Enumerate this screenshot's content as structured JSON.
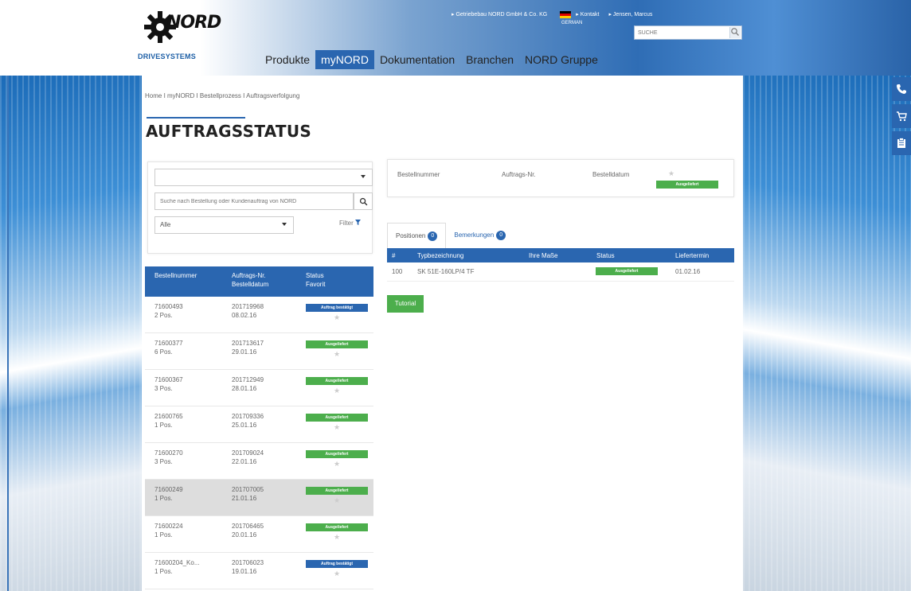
{
  "header": {
    "logo_text": "NORD",
    "logo_sub": "DRIVESYSTEMS",
    "top_links": [
      "Getriebebau NORD GmbH & Co. KG",
      "Kontakt",
      "Jensen, Marcus"
    ],
    "language": "GERMAN",
    "search_placeholder": "SUCHE",
    "nav": [
      "Produkte",
      "myNORD",
      "Dokumentation",
      "Branchen",
      "NORD Gruppe"
    ],
    "active_nav": "myNORD"
  },
  "breadcrumb": "Home I myNORD I Bestellprozess I Auftragsverfolgung",
  "page_title": "AUFTRAGSSTATUS",
  "filter": {
    "dropdown_value": "",
    "search_placeholder": "Suche nach Bestellung oder Kundenauftrag von NORD",
    "status_value": "Alle",
    "filter_label": "Filter"
  },
  "orders": {
    "headers": {
      "col1": "Bestellnummer",
      "col2a": "Auftrags-Nr.",
      "col2b": "Bestelldatum",
      "col3a": "Status",
      "col3b": "Favorit"
    },
    "rows": [
      {
        "order": "71600493",
        "pos": "2 Pos.",
        "auftrag": "201719968",
        "date": "08.02.16",
        "status": "Auftrag bestätigt",
        "status_color": "#2a66b0",
        "selected": false
      },
      {
        "order": "71600377",
        "pos": "6 Pos.",
        "auftrag": "201713617",
        "date": "29.01.16",
        "status": "Ausgeliefert",
        "status_color": "#4cae4c",
        "selected": false
      },
      {
        "order": "71600367",
        "pos": "3 Pos.",
        "auftrag": "201712949",
        "date": "28.01.16",
        "status": "Ausgeliefert",
        "status_color": "#4cae4c",
        "selected": false
      },
      {
        "order": "21600765",
        "pos": "1 Pos.",
        "auftrag": "201709336",
        "date": "25.01.16",
        "status": "Ausgeliefert",
        "status_color": "#4cae4c",
        "selected": false
      },
      {
        "order": "71600270",
        "pos": "3 Pos.",
        "auftrag": "201709024",
        "date": "22.01.16",
        "status": "Ausgeliefert",
        "status_color": "#4cae4c",
        "selected": false
      },
      {
        "order": "71600249",
        "pos": "1 Pos.",
        "auftrag": "201707005",
        "date": "21.01.16",
        "status": "Ausgeliefert",
        "status_color": "#4cae4c",
        "selected": true
      },
      {
        "order": "71600224",
        "pos": "1 Pos.",
        "auftrag": "201706465",
        "date": "20.01.16",
        "status": "Ausgeliefert",
        "status_color": "#4cae4c",
        "selected": false
      },
      {
        "order": "71600204_Ko...",
        "pos": "1 Pos.",
        "auftrag": "201706023",
        "date": "19.01.16",
        "status": "Auftrag bestätigt",
        "status_color": "#2a66b0",
        "selected": false
      }
    ]
  },
  "detail": {
    "label_bestellnummer": "Bestellnummer",
    "label_auftrag": "Auftrags-Nr.",
    "label_datum": "Bestelldatum",
    "status": "Ausgeliefert"
  },
  "tabs": [
    {
      "label": "Positionen",
      "count": "0"
    },
    {
      "label": "Bemerkungen",
      "count": "0"
    }
  ],
  "positions": {
    "headers": [
      "#",
      "Typbezeichnung",
      "Ihre Maße",
      "Status",
      "Liefertermin"
    ],
    "rows": [
      {
        "num": "100",
        "type": "SK 51E-160LP/4 TF",
        "masse": "",
        "status": "Ausgeliefert",
        "date": "01.02.16"
      }
    ]
  },
  "tutorial_label": "Tutorial",
  "colors": {
    "brand_blue": "#2a66b0",
    "status_green": "#4cae4c"
  }
}
